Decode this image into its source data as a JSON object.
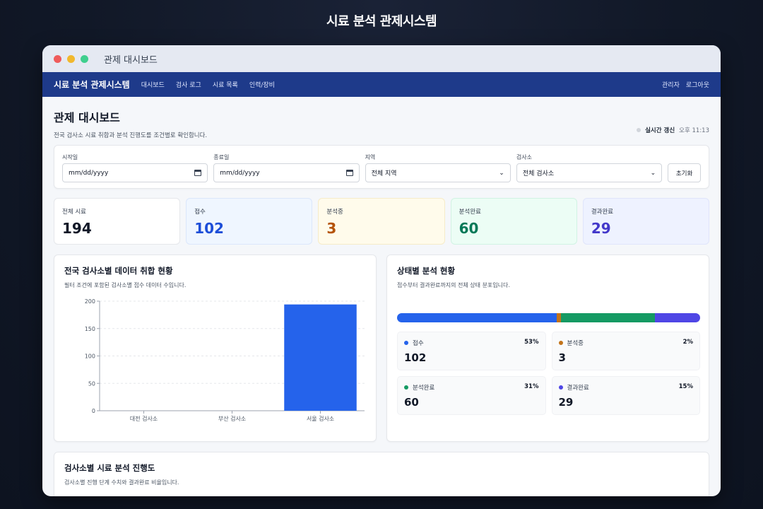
{
  "page": {
    "title": "시료 분석 관제시스템"
  },
  "window": {
    "title": "관제 대시보드"
  },
  "nav": {
    "brand": "시료 분석 관제시스템",
    "links": [
      "대시보드",
      "검사 로그",
      "시료 목록",
      "인력/장비"
    ],
    "user": "관리자",
    "logout": "로그아웃"
  },
  "dashboard": {
    "title": "관제 대시보드",
    "subtitle": "전국 검사소 시료 취합과 분석 진행도를 조건별로 확인합니다.",
    "live_label": "실시간 갱신",
    "live_time": "오후 11:13"
  },
  "filters": {
    "start_label": "시작일",
    "start_value": "mm/dd/yyyy",
    "end_label": "종료일",
    "end_value": "mm/dd/yyyy",
    "region_label": "지역",
    "region_value": "전체 지역",
    "lab_label": "검사소",
    "lab_value": "전체 검사소",
    "reset_label": "초기화"
  },
  "stats": [
    {
      "label": "전체 시료",
      "value": "194",
      "color": "#111827",
      "bg": "#ffffff",
      "border": "#e5e7eb"
    },
    {
      "label": "접수",
      "value": "102",
      "color": "#1d4ed8",
      "bg": "#eff6ff",
      "border": "#dbe7fb"
    },
    {
      "label": "분석중",
      "value": "3",
      "color": "#b45309",
      "bg": "#fffbeb",
      "border": "#f6ecc9"
    },
    {
      "label": "분석완료",
      "value": "60",
      "color": "#047857",
      "bg": "#ecfdf5",
      "border": "#d1f3e3"
    },
    {
      "label": "결과완료",
      "value": "29",
      "color": "#4338ca",
      "bg": "#eef2ff",
      "border": "#e0e5fb"
    }
  ],
  "bar_card": {
    "title": "전국 검사소별 데이터 취합 현황",
    "subtitle": "필터 조건에 포함된 검사소별 접수 데이터 수입니다."
  },
  "chart_data": {
    "type": "bar",
    "categories": [
      "대전 검사소",
      "부산 검사소",
      "서울 검사소"
    ],
    "values": [
      0,
      0,
      194
    ],
    "ylim": [
      0,
      200
    ],
    "yticks": [
      0,
      50,
      100,
      150,
      200
    ],
    "grid": true,
    "color": "#2563eb"
  },
  "status_card": {
    "title": "상태별 분석 현황",
    "subtitle": "접수부터 결과완료까지의 전체 상태 분포입니다.",
    "items": [
      {
        "label": "접수",
        "value": "102",
        "pct": "53%",
        "share": 0.526,
        "color": "#2563eb"
      },
      {
        "label": "분석중",
        "value": "3",
        "pct": "2%",
        "share": 0.015,
        "color": "#c2731a"
      },
      {
        "label": "분석완료",
        "value": "60",
        "pct": "31%",
        "share": 0.309,
        "color": "#159a63"
      },
      {
        "label": "결과완료",
        "value": "29",
        "pct": "15%",
        "share": 0.15,
        "color": "#4f46e5"
      }
    ]
  },
  "progress_card": {
    "title": "검사소별 시료 분석 진행도",
    "subtitle": "검사소별 진행 단계 수치와 결과완료 비율입니다."
  }
}
